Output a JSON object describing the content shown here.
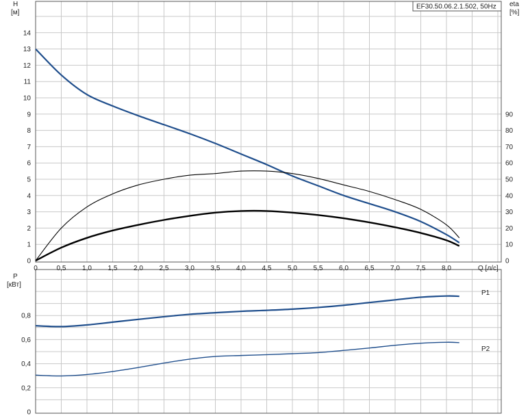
{
  "chart_data": [
    {
      "type": "line",
      "title": "EF30.50.06.2.1.502, 50Hz",
      "xlabel": "Q [л/с]",
      "x_ticks": [
        "0",
        "0,5",
        "1,0",
        "1,5",
        "2,0",
        "2,5",
        "3,0",
        "3,5",
        "4,0",
        "4,5",
        "5,0",
        "5,5",
        "6,0",
        "6,5",
        "7,0",
        "7,5",
        "8,0"
      ],
      "xlim": [
        0,
        9
      ],
      "left_axis": {
        "label_top": "H",
        "label_unit": "[м]",
        "ylim": [
          0,
          15
        ],
        "ticks": [
          "0",
          "1",
          "2",
          "3",
          "4",
          "5",
          "6",
          "7",
          "8",
          "9",
          "10",
          "11",
          "12",
          "13",
          "14"
        ]
      },
      "right_axis": {
        "label_top": "eta",
        "label_unit": "[%]",
        "ylim": [
          0,
          150
        ],
        "ticks": [
          "0",
          "10",
          "20",
          "30",
          "40",
          "50",
          "60",
          "70",
          "80",
          "90"
        ]
      },
      "grid": true,
      "series": [
        {
          "axis": "left",
          "color": "#1f4e8c",
          "x": [
            0,
            0.5,
            1.0,
            1.5,
            2.0,
            2.5,
            3.0,
            3.5,
            4.0,
            4.5,
            5.0,
            5.5,
            6.0,
            6.5,
            7.0,
            7.5,
            8.0,
            8.25
          ],
          "values": [
            13.0,
            11.4,
            10.2,
            9.5,
            8.9,
            8.35,
            7.8,
            7.2,
            6.55,
            5.9,
            5.2,
            4.6,
            4.0,
            3.5,
            3.0,
            2.4,
            1.6,
            1.1
          ]
        },
        {
          "axis": "right",
          "color": "#000000",
          "x": [
            0,
            0.5,
            1.0,
            1.5,
            2.0,
            2.5,
            3.0,
            3.5,
            4.0,
            4.5,
            5.0,
            5.5,
            6.0,
            6.5,
            7.0,
            7.5,
            8.0,
            8.25
          ],
          "values": [
            0,
            20,
            33,
            41,
            46.5,
            50,
            52.5,
            53.5,
            55,
            55,
            53.5,
            50.5,
            46.5,
            42.5,
            37.5,
            31.5,
            22,
            14
          ]
        },
        {
          "axis": "right",
          "color": "#000000",
          "x": [
            0,
            0.5,
            1.0,
            1.5,
            2.0,
            2.5,
            3.0,
            3.5,
            4.0,
            4.5,
            5.0,
            5.5,
            6.0,
            6.5,
            7.0,
            7.5,
            8.0,
            8.25
          ],
          "values": [
            0,
            8,
            14,
            18.5,
            22,
            25,
            27.5,
            29.5,
            30.5,
            30.5,
            29.5,
            28,
            26,
            23.5,
            20.5,
            17,
            12.5,
            9
          ]
        }
      ]
    },
    {
      "type": "line",
      "xlim": [
        0,
        9
      ],
      "left_axis": {
        "label_top": "P",
        "label_unit": "[кВт]",
        "ylim": [
          0,
          1.0
        ],
        "ticks": [
          "0",
          "0,2",
          "0,4",
          "0,6",
          "0,8"
        ]
      },
      "grid": true,
      "series": [
        {
          "name": "P1",
          "color": "#1f4e8c",
          "x": [
            0,
            0.5,
            1.0,
            1.5,
            2.0,
            2.5,
            3.0,
            3.5,
            4.0,
            4.5,
            5.0,
            5.5,
            6.0,
            6.5,
            7.0,
            7.5,
            8.0,
            8.25
          ],
          "values": [
            0.715,
            0.708,
            0.722,
            0.745,
            0.768,
            0.79,
            0.81,
            0.823,
            0.835,
            0.843,
            0.853,
            0.867,
            0.885,
            0.908,
            0.93,
            0.952,
            0.962,
            0.96
          ]
        },
        {
          "name": "P2",
          "color": "#1f4e8c",
          "x": [
            0,
            0.5,
            1.0,
            1.5,
            2.0,
            2.5,
            3.0,
            3.5,
            4.0,
            4.5,
            5.0,
            5.5,
            6.0,
            6.5,
            7.0,
            7.5,
            8.0,
            8.25
          ],
          "values": [
            0.305,
            0.298,
            0.31,
            0.335,
            0.368,
            0.405,
            0.438,
            0.46,
            0.468,
            0.475,
            0.483,
            0.492,
            0.51,
            0.53,
            0.553,
            0.57,
            0.578,
            0.575
          ]
        }
      ]
    }
  ]
}
